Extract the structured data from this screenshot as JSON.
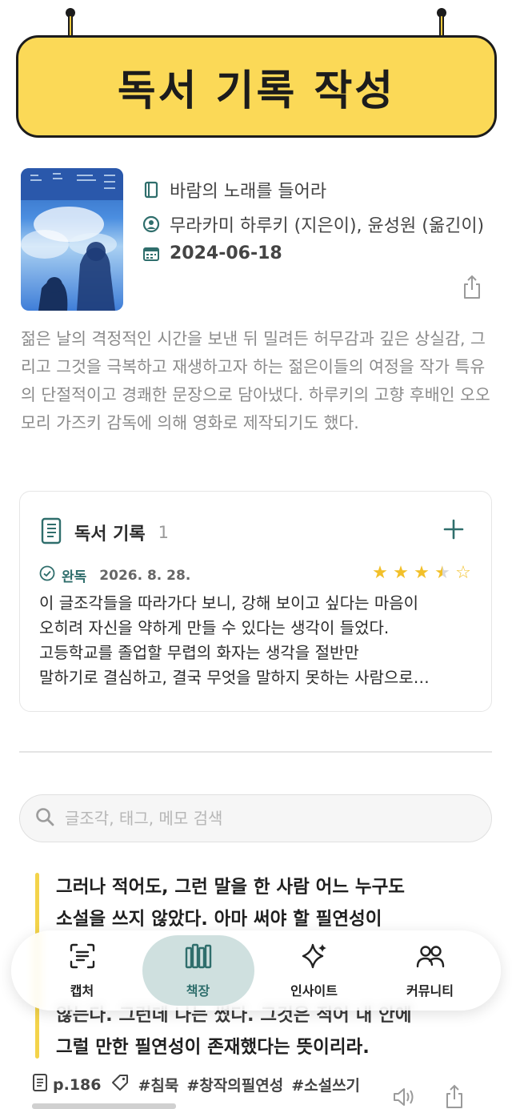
{
  "header": {
    "title": "독서 기록 작성"
  },
  "book": {
    "title": "바람의 노래를 들어라",
    "author": "무라카미 하루키 (지은이), 윤성원 (옮긴이)",
    "date": "2024-06-18",
    "icons": {
      "title": "book-icon",
      "author": "person-icon",
      "date": "calendar-icon",
      "share": "share-icon"
    },
    "description": "젊은 날의 격정적인 시간을 보낸 뒤 밀려든 허무감과 깊은 상실감, 그리고 그것을 극복하고 재생하고자 하는 젊은이들의 여정을 작가 특유의 단절적이고 경쾌한 문장으로 담아냈다. 하루키의 고향 후배인 오오모리 가즈키 감독에 의해 영화로 제작되기도 했다."
  },
  "record_card": {
    "title": "독서 기록",
    "count": "1",
    "status": "완독",
    "date": "2026. 8. 28.",
    "rating": 3.5,
    "rating_max": 5,
    "lines": [
      "이 글조각들을 따라가다 보니, 강해 보이고 싶다는 마음이",
      "오히려 자신을 약하게 만들 수 있다는 생각이 들었다.",
      "고등학교를 졸업할 무렵의 화자는 생각을 절반만",
      "말하기로 결심하고, 결국 무엇을 말하지 못하는 사람으로…"
    ]
  },
  "search": {
    "placeholder": "글조각, 태그, 메모 검색",
    "value": ""
  },
  "quote": {
    "lines": [
      "그러나 적어도, 그런 말을 한 사람 어느 누구도",
      "소설을 쓰지 않았다. 아마 써야 할 필연성이",
      "않는다. 그런데 나는 썼다. 그것은 적어 내 안에",
      "그럴 만한 필연성이 존재했다는 뜻이리라."
    ],
    "page": "p.186",
    "tags": [
      "#침묵",
      "#창작의필연성",
      "#소설쓰기"
    ]
  },
  "nav": {
    "items": [
      {
        "label": "캡처",
        "icon": "capture-icon"
      },
      {
        "label": "책장",
        "icon": "bookshelf-icon"
      },
      {
        "label": "인사이트",
        "icon": "sparkle-icon"
      },
      {
        "label": "커뮤니티",
        "icon": "community-icon"
      }
    ],
    "active": "책장"
  },
  "colors": {
    "accent": "#2f6e6c",
    "header_yellow": "#fbd957",
    "star": "#f2c029",
    "quote_bar": "#f3d34a",
    "nav_active_bg": "#cfe0df"
  }
}
